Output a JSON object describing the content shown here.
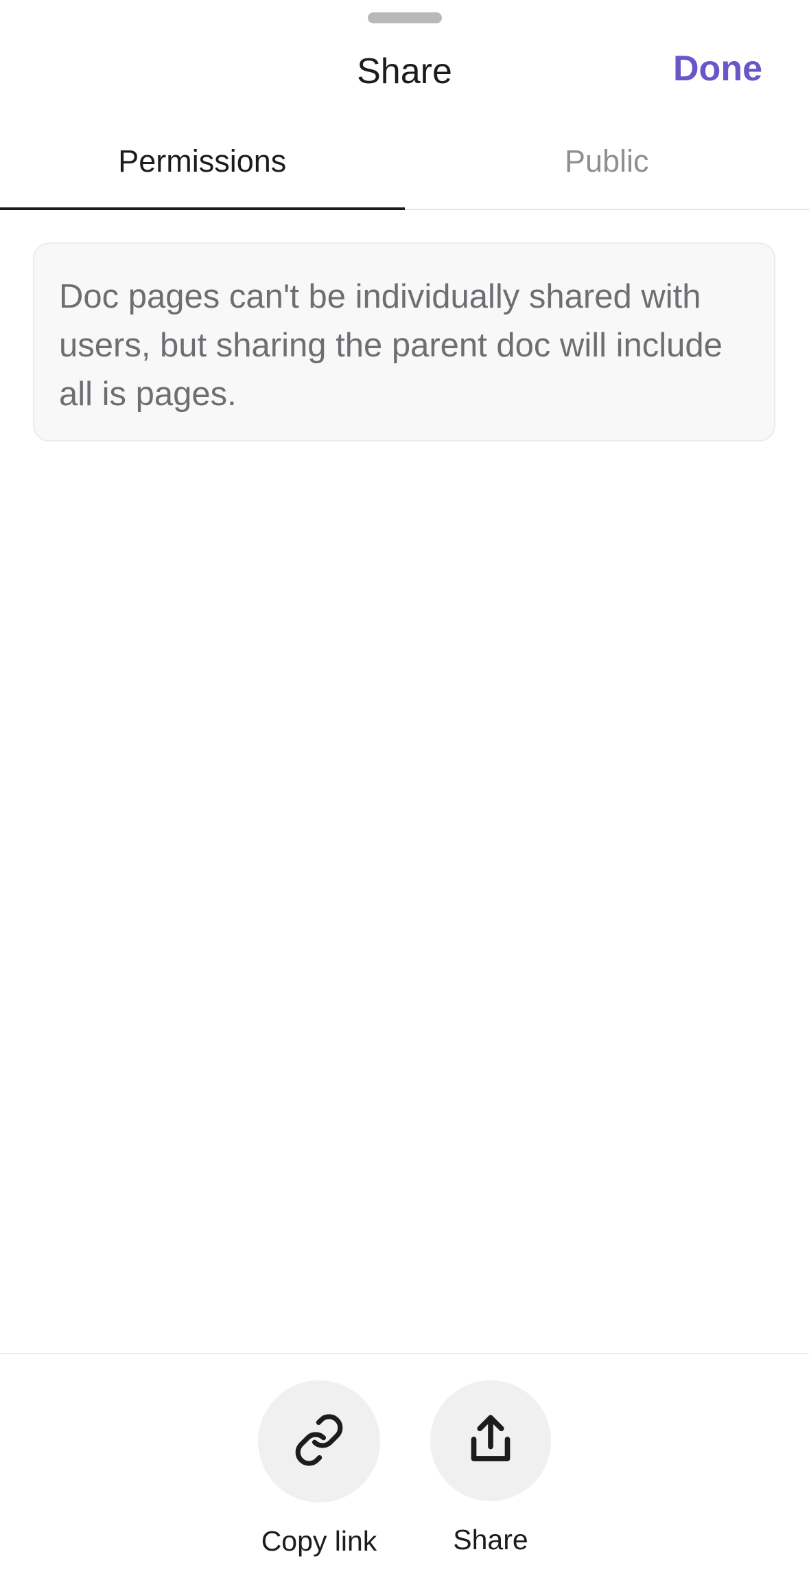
{
  "header": {
    "title": "Share",
    "done_label": "Done"
  },
  "tabs": [
    {
      "label": "Permissions",
      "active": true
    },
    {
      "label": "Public",
      "active": false
    }
  ],
  "info": {
    "message": "Doc pages can't be individually shared with users, but sharing the parent doc will include all is pages."
  },
  "actions": [
    {
      "label": "Copy link",
      "icon": "link-icon"
    },
    {
      "label": "Share",
      "icon": "share-icon"
    }
  ],
  "colors": {
    "accent": "#6a55c9",
    "text_primary": "#1c1c1e",
    "text_secondary": "#8e8e93",
    "info_background": "#f8f8f8",
    "action_background": "#f0f0f1"
  }
}
